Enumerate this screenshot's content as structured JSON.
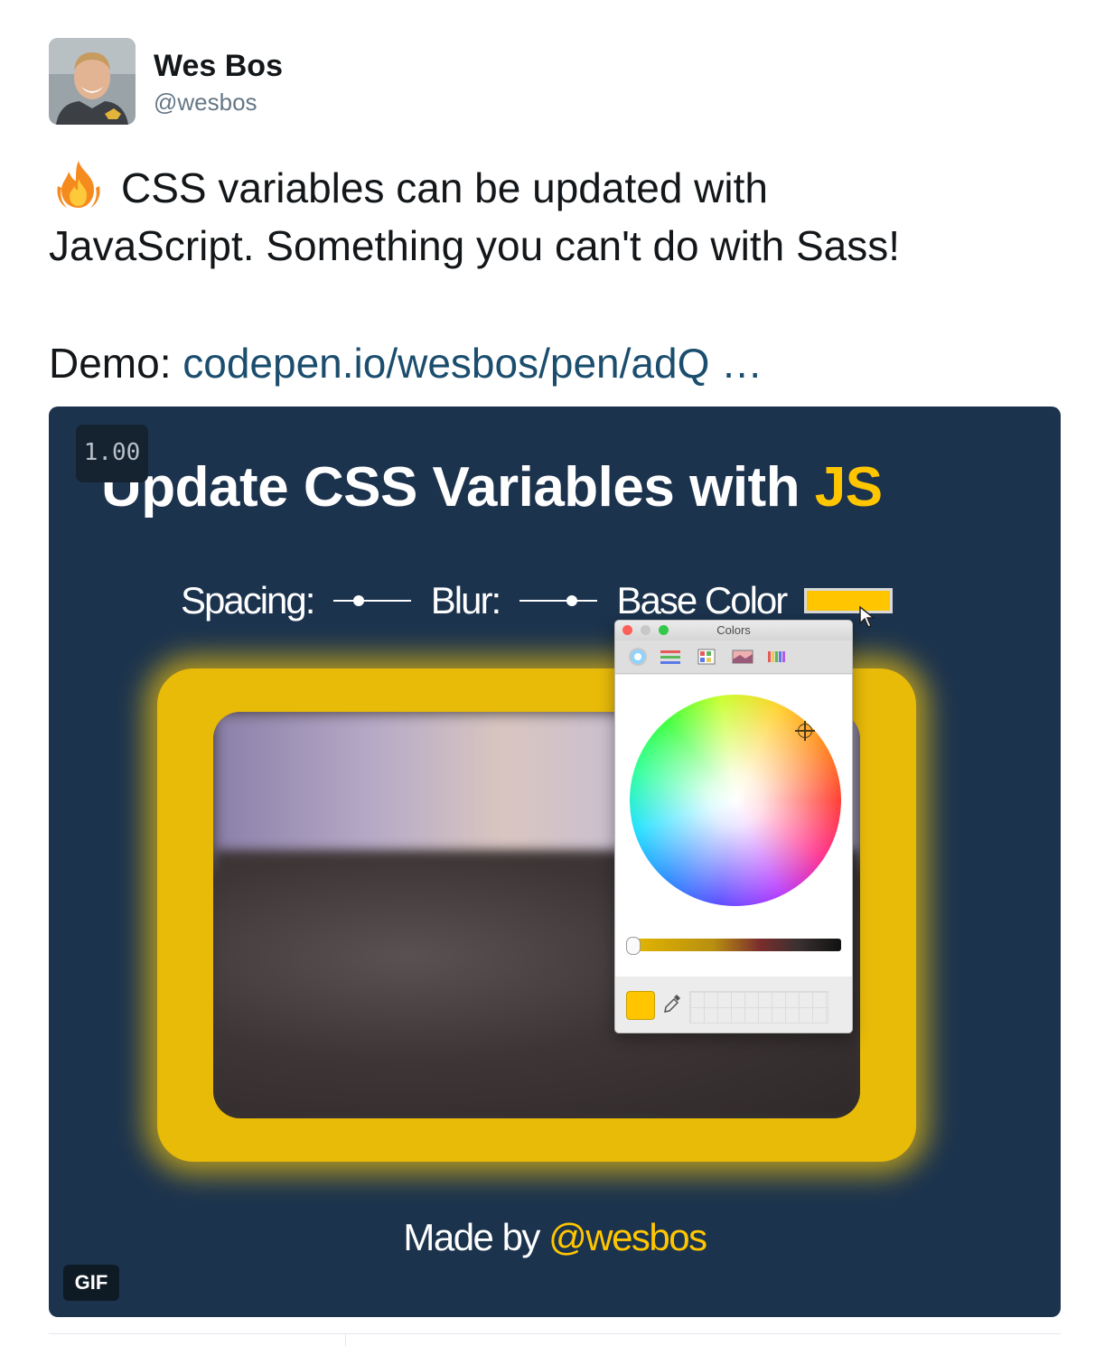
{
  "author": {
    "name": "Wes Bos",
    "handle": "@wesbos",
    "avatar_icon": "profile-photo"
  },
  "tweet": {
    "emoji": "fire-emoji",
    "line1": "CSS variables can be updated with",
    "line2": "JavaScript. Something you can't do with Sass!",
    "demo_label": "Demo:",
    "demo_link": "codepen.io/wesbos/pen/adQ …"
  },
  "media": {
    "frame_counter": "1.00",
    "title_main": "Update CSS Variables with ",
    "title_accent": "JS",
    "controls": {
      "spacing_label": "Spacing:",
      "blur_label": "Blur:",
      "base_color_label": "Base Color",
      "base_color_value": "#ffc600"
    },
    "made_by_prefix": "Made by ",
    "made_by_handle": "@wesbos",
    "badge": "GIF",
    "colors": {
      "background": "#1c334e",
      "accent": "#ffc600",
      "link": "#1b4e6e"
    }
  },
  "color_panel": {
    "title": "Colors",
    "tabs": [
      "color-wheel-icon",
      "sliders-icon",
      "palettes-icon",
      "image-palette-icon",
      "crayons-icon"
    ],
    "current_color": "#ffc600"
  }
}
